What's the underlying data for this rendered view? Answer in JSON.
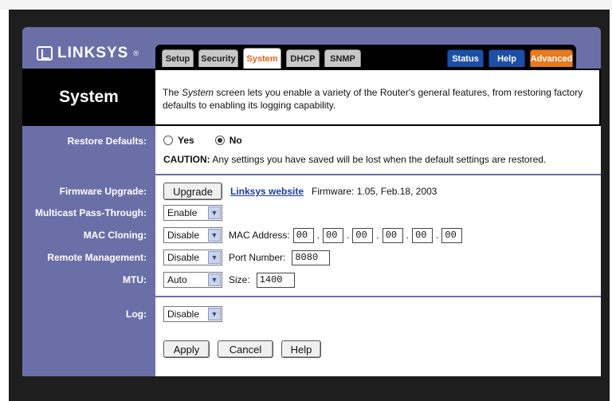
{
  "brand": {
    "name": "Linksys",
    "logo_text": "LINKSYS",
    "reg": "®"
  },
  "tabs": [
    {
      "label": "Setup",
      "active": false,
      "style": "gray"
    },
    {
      "label": "Security",
      "active": false,
      "style": "gray"
    },
    {
      "label": "System",
      "active": true,
      "style": "gray"
    },
    {
      "label": "DHCP",
      "active": false,
      "style": "gray"
    },
    {
      "label": "SNMP",
      "active": false,
      "style": "gray"
    },
    {
      "label": "Status",
      "active": false,
      "style": "blue"
    },
    {
      "label": "Help",
      "active": false,
      "style": "blue"
    },
    {
      "label": "Advanced",
      "active": false,
      "style": "orange"
    }
  ],
  "page": {
    "title": "System",
    "description_pre": "The ",
    "description_em": "System",
    "description_post": " screen lets you enable a variety of the Router's general features, from restoring factory defaults to enabling its logging capability."
  },
  "restore_defaults": {
    "label": "Restore Defaults:",
    "yes_label": "Yes",
    "no_label": "No",
    "selected": "No",
    "caution_prefix": "CAUTION:",
    "caution_text": " Any settings you have saved will be lost when the default settings are restored."
  },
  "firmware": {
    "label": "Firmware Upgrade:",
    "upgrade_button": "Upgrade",
    "link_text": "Linksys website",
    "firmware_text": "Firmware: 1.05, Feb.18, 2003"
  },
  "multicast": {
    "label": "Multicast Pass-Through:",
    "value": "Enable"
  },
  "mac_cloning": {
    "label": "MAC Cloning:",
    "value": "Disable",
    "mac_label": "MAC Address:",
    "octets": [
      "00",
      "00",
      "00",
      "00",
      "00",
      "00"
    ]
  },
  "remote_mgmt": {
    "label": "Remote Management:",
    "value": "Disable",
    "port_label": "Port Number:",
    "port": "8080"
  },
  "mtu": {
    "label": "MTU:",
    "value": "Auto",
    "size_label": "Size:",
    "size": "1400"
  },
  "log": {
    "label": "Log:",
    "value": "Disable"
  },
  "buttons": {
    "apply": "Apply",
    "cancel": "Cancel",
    "help": "Help"
  },
  "colors": {
    "panel": "#6b6fa8",
    "accent_orange": "#e87a1f",
    "tab_blue": "#1d4fa8",
    "link": "#1c3aa8"
  }
}
